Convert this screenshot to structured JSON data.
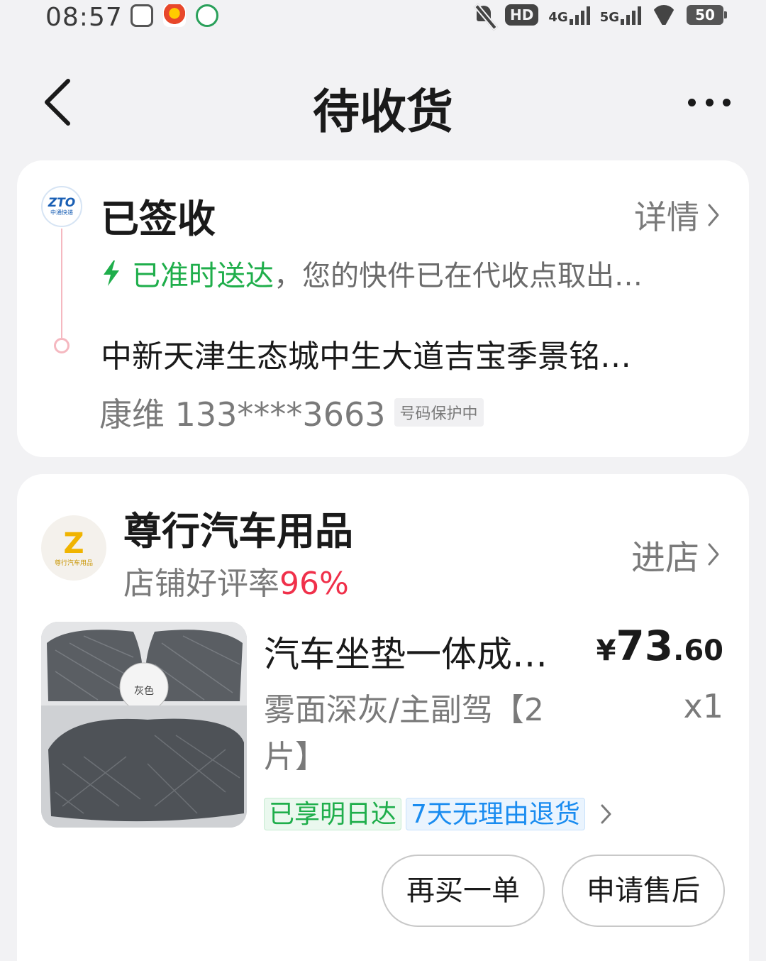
{
  "status_bar": {
    "time": "08:57",
    "hd_label": "HD",
    "net1": "4G",
    "net2": "5G",
    "battery": "50"
  },
  "header": {
    "title": "待收货"
  },
  "delivery": {
    "status_title": "已签收",
    "details_label": "详情",
    "courier_logo_text": "ZTO",
    "courier_logo_sub": "中通快递",
    "ontime_label": "已准时送达",
    "status_message": "，您的快件已在代收点取出…",
    "address": "中新天津生态城中生大道吉宝季景铭…",
    "contact": "康维 133****3663",
    "privacy_badge": "号码保护中"
  },
  "order": {
    "store_name": "尊行汽车用品",
    "store_logo_letter": "Z",
    "store_logo_sub": "尊行汽车用品",
    "rating_label": "店铺好评率",
    "rating_value": "96%",
    "enter_store_label": "进店",
    "product": {
      "name": "汽车坐垫一体成…",
      "price_symbol": "¥",
      "price_int": "73",
      "price_dec": ".60",
      "variant": "雾面深灰/主副驾【2片】",
      "quantity": "x1",
      "tags": [
        "已享明日达",
        "7天无理由退货"
      ],
      "image_label": "灰色"
    },
    "buttons": {
      "rebuy": "再买一单",
      "after_sale": "申请售后"
    }
  },
  "colors": {
    "accent_green": "#1fae4b",
    "accent_blue": "#1a8cf0",
    "rating_red": "#f0304a",
    "background": "#f2f2f4"
  }
}
